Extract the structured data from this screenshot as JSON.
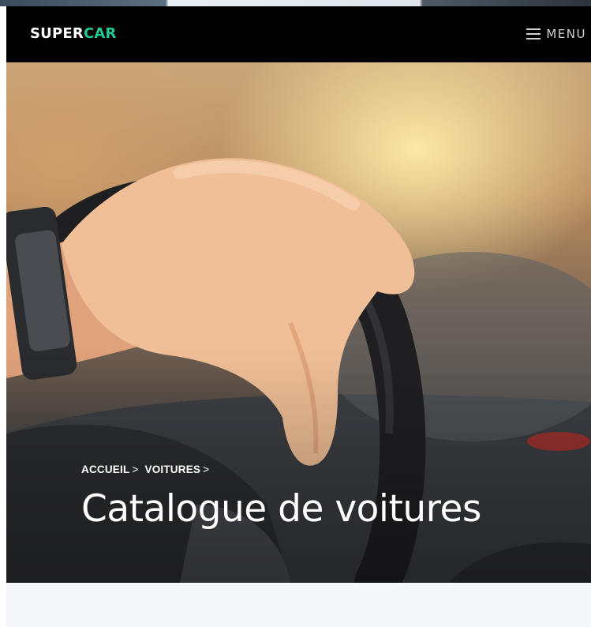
{
  "header": {
    "logo_part1": "SUPER",
    "logo_part2": "CAR",
    "menu_label": "MENU",
    "menu_icon": "hamburger-icon"
  },
  "hero": {
    "image": "hand-on-steering-wheel-photo",
    "breadcrumb": [
      {
        "label": "ACCUEIL",
        "separator": ">"
      },
      {
        "label": "VOITURES",
        "separator": ">"
      }
    ],
    "title": "Catalogue de voitures"
  },
  "colors": {
    "navbar_bg": "#000000",
    "logo_accent": "#20c997",
    "text": "#ffffff",
    "section_bg": "#f5f7fa"
  }
}
